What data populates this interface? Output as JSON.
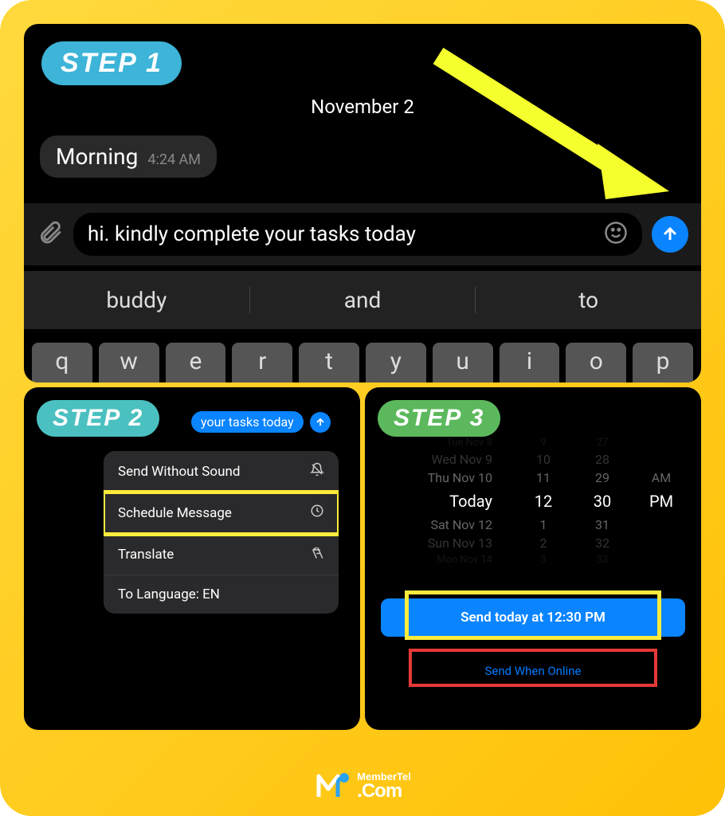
{
  "steps": {
    "1": "STEP 1",
    "2": "STEP 2",
    "3": "STEP 3"
  },
  "date_header": "November 2",
  "incoming": {
    "text": "Morning",
    "time": "4:24 AM"
  },
  "compose": {
    "text": "hi. kindly complete your tasks today"
  },
  "suggestions": [
    "buddy",
    "and",
    "to"
  ],
  "keys": [
    "q",
    "w",
    "e",
    "r",
    "t",
    "y",
    "u",
    "i",
    "o",
    "p"
  ],
  "step2_bubble": "your tasks today",
  "menu": {
    "send_without_sound": "Send Without Sound",
    "schedule_message": "Schedule Message",
    "translate": "Translate",
    "to_language": "To Language: EN"
  },
  "wheel": {
    "rows": [
      {
        "day": "Tue Nov 8",
        "h": "9",
        "m": "27",
        "ampm": ""
      },
      {
        "day": "Wed Nov 9",
        "h": "10",
        "m": "28",
        "ampm": ""
      },
      {
        "day": "Thu Nov 10",
        "h": "11",
        "m": "29",
        "ampm": "AM"
      },
      {
        "day": "Today",
        "h": "12",
        "m": "30",
        "ampm": "PM"
      },
      {
        "day": "Sat Nov 12",
        "h": "1",
        "m": "31",
        "ampm": ""
      },
      {
        "day": "Sun Nov 13",
        "h": "2",
        "m": "32",
        "ampm": ""
      },
      {
        "day": "Mon Nov 14",
        "h": "3",
        "m": "33",
        "ampm": ""
      }
    ]
  },
  "send_today": "Send today at 12:30 PM",
  "send_when_online": "Send When Online",
  "logo": {
    "line1": "MemberTel",
    "line2": ".Com"
  }
}
